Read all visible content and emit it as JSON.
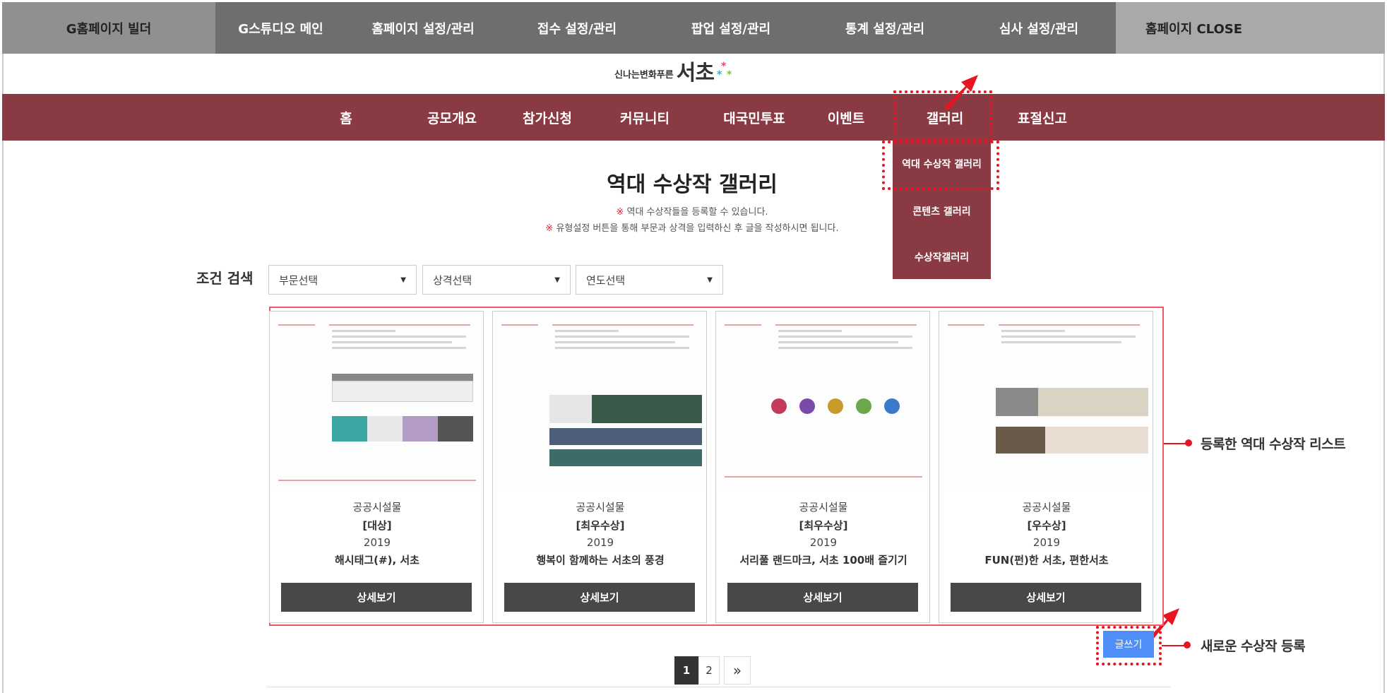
{
  "admin_bar": {
    "items": [
      "G홈페이지 빌더",
      "G스튜디오 메인",
      "홈페이지 설정/관리",
      "접수 설정/관리",
      "팝업 설정/관리",
      "통계 설정/관리",
      "심사 설정/관리",
      "홈페이지 CLOSE"
    ]
  },
  "logo": {
    "small": "신나는변화푸른",
    "big": "서초"
  },
  "main_nav": {
    "items": [
      "홈",
      "공모개요",
      "참가신청",
      "커뮤니티",
      "대국민투표",
      "이벤트",
      "갤러리",
      "표절신고"
    ]
  },
  "gallery_dropdown": {
    "items": [
      "역대 수상작 갤러리",
      "콘텐츠 갤러리",
      "수상작갤러리"
    ]
  },
  "page": {
    "title": "역대 수상작 갤러리",
    "notice_1_mark": "※",
    "notice_1": "역대 수상작들을 등록할 수 있습니다.",
    "notice_2_mark": "※",
    "notice_2": "유형설정 버튼을 통해 부문과 상격을 입력하신 후 글을 작성하시면 됩니다."
  },
  "search": {
    "label": "조건 검색",
    "filters": [
      {
        "selected": "부문선택"
      },
      {
        "selected": "상격선택"
      },
      {
        "selected": "연도선택"
      }
    ]
  },
  "cards": [
    {
      "category": "공공시설물",
      "award": "[대상]",
      "year": "2019",
      "name": "해시태그(#), 서초",
      "button": "상세보기"
    },
    {
      "category": "공공시설물",
      "award": "[최우수상]",
      "year": "2019",
      "name": "행복이 함께하는 서초의 풍경",
      "button": "상세보기"
    },
    {
      "category": "공공시설물",
      "award": "[최우수상]",
      "year": "2019",
      "name": "서리풀 랜드마크, 서초 100배 즐기기",
      "button": "상세보기"
    },
    {
      "category": "공공시설물",
      "award": "[우수상]",
      "year": "2019",
      "name": "FUN(펀)한 서초, 편한서초",
      "button": "상세보기"
    }
  ],
  "write_button": "글쓰기",
  "pagination": {
    "pages": [
      "1",
      "2"
    ],
    "next": "»",
    "current": "1"
  },
  "annotations": {
    "list": "등록한 역대 수상작 리스트",
    "write": "새로운 수상작 등록"
  },
  "colors": {
    "nav_bg": "#8a3a42",
    "admin_bg": "#6e6e6e",
    "highlight": "#e8141f",
    "write_button": "#4f8ef7"
  }
}
